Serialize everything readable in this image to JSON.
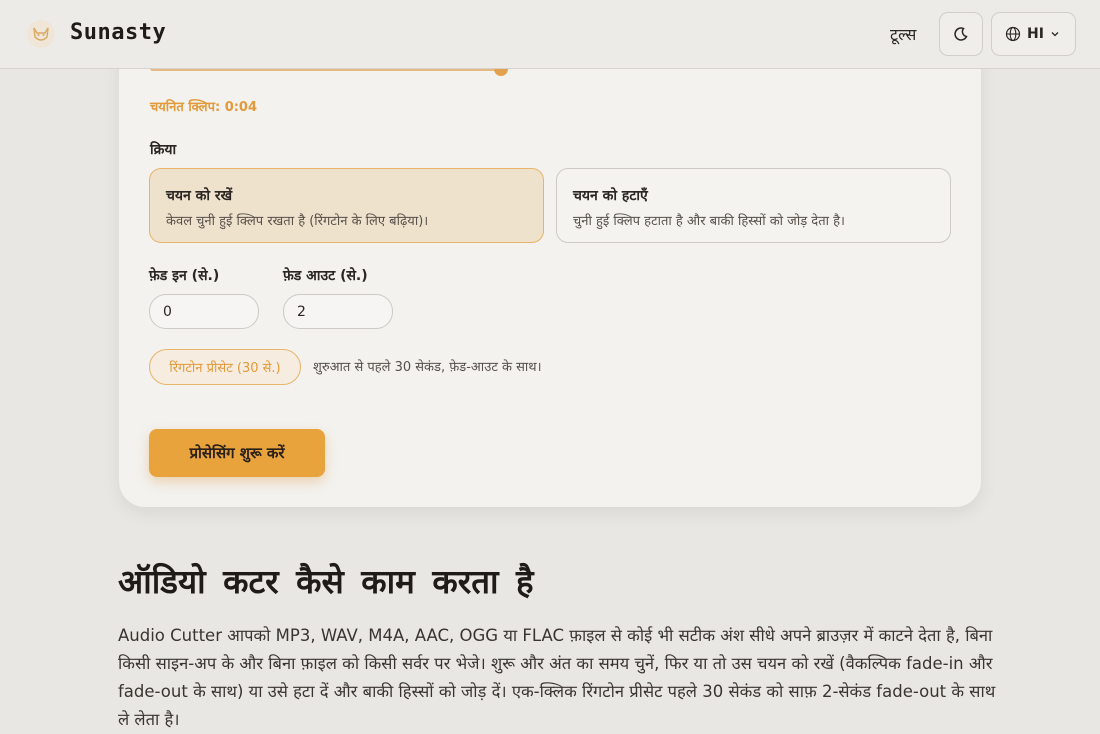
{
  "header": {
    "brand": "Sunasty",
    "nav_tools": "टूल्स",
    "lang_label": "HI"
  },
  "clip": {
    "selected_label": "चयनित क्लिप: 0:04"
  },
  "action": {
    "label": "क्रिया",
    "keep": {
      "title": "चयन को रखें",
      "desc": "केवल चुनी हुई क्लिप रखता है (रिंगटोन के लिए बढ़िया)।"
    },
    "remove": {
      "title": "चयन को हटाएँ",
      "desc": "चुनी हुई क्लिप हटाता है और बाकी हिस्सों को जोड़ देता है।"
    }
  },
  "fade": {
    "in_label": "फ़ेड इन (से.)",
    "in_value": "0",
    "out_label": "फ़ेड आउट (से.)",
    "out_value": "2"
  },
  "preset": {
    "button": "रिंगटोन प्रीसेट (30 से.)",
    "note": "शुरुआत से पहले 30 सेकंड, फ़ेड-आउट के साथ।"
  },
  "start_button": "प्रोसेसिंग शुरू करें",
  "how": {
    "title": "ऑडियो कटर कैसे काम करता है",
    "body": "Audio Cutter आपको MP3, WAV, M4A, AAC, OGG या FLAC फ़ाइल से कोई भी सटीक अंश सीधे अपने ब्राउज़र में काटने देता है, बिना किसी साइन-अप के और बिना फ़ाइल को किसी सर्वर पर भेजे। शुरू और अंत का समय चुनें, फिर या तो उस चयन को रखें (वैकल्पिक fade-in और fade-out के साथ) या उसे हटा दें और बाकी हिस्सों को जोड़ दें। एक-क्लिक रिंगटोन प्रीसेट पहले 30 सेकंड को साफ़ 2-सेकंड fade-out के साथ ले लेता है।"
  },
  "colors": {
    "accent": "#e8a33c",
    "accent_text": "#e29a3a",
    "card_bg": "#f3f2ef"
  },
  "slider": {
    "progress_fraction": 1.0
  }
}
